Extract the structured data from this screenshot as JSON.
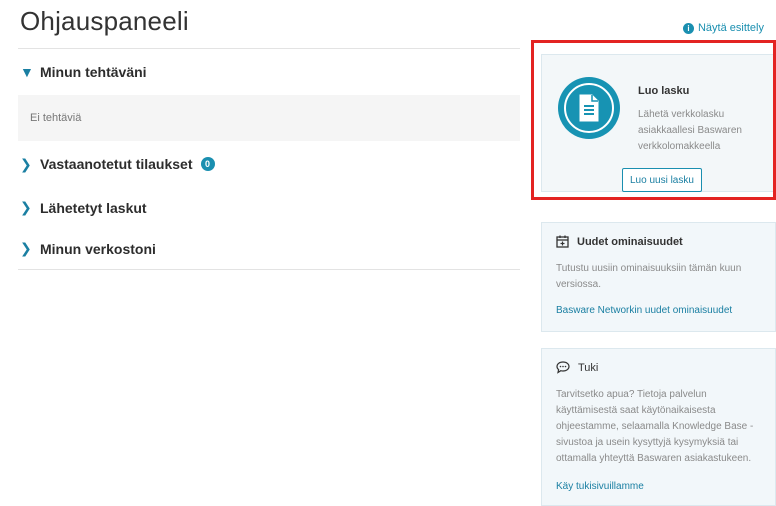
{
  "page": {
    "title": "Ohjauspaneeli",
    "tour_link": "Näytä esittely"
  },
  "sections": [
    {
      "label": "Minun tehtäväni",
      "expanded": true,
      "empty_text": "Ei tehtäviä"
    },
    {
      "label": "Vastaanotetut tilaukset",
      "badge": "0"
    },
    {
      "label": "Lähetetyt laskut"
    },
    {
      "label": "Minun verkostoni"
    }
  ],
  "invoice_card": {
    "title": "Luo lasku",
    "description": "Lähetä verkkolasku asiakkaallesi Baswaren verkkolomakkeella",
    "button": "Luo uusi lasku"
  },
  "features_card": {
    "title": "Uudet ominaisuudet",
    "text": "Tutustu uusiin ominaisuuksiin tämän kuun versiossa.",
    "link": "Basware Networkin uudet ominaisuudet"
  },
  "support_card": {
    "title": "Tuki",
    "text": "Tarvitsetko apua? Tietoja palvelun käyttämisestä saat käytönaikaisesta ohjeestamme, selaamalla Knowledge Base -sivustoa ja usein kysyttyjä kysymyksiä tai ottamalla yhteyttä Baswaren asiakastukeen.",
    "link": "Käy tukisivuillamme"
  },
  "colors": {
    "accent": "#1a8fb0",
    "highlight_border": "#e32322",
    "card_bg": "#f2f7fa"
  }
}
